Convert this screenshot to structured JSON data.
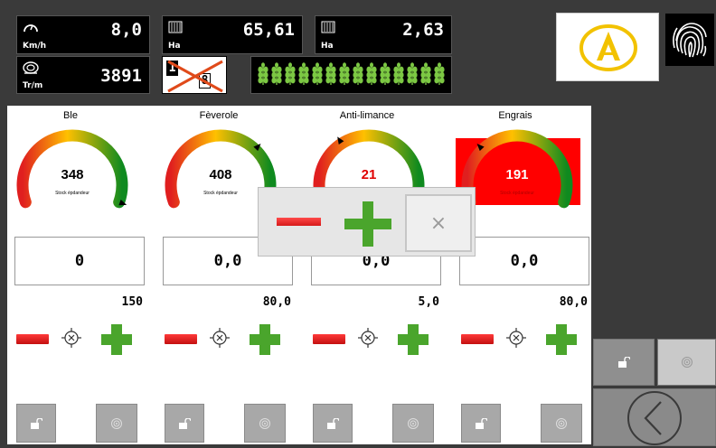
{
  "header": {
    "speed": {
      "value": "8,0",
      "unit": "Km/h",
      "icon": "speedometer-icon"
    },
    "area_total": {
      "value": "65,61",
      "unit": "Ha",
      "icon": "field-icon"
    },
    "area_partial": {
      "value": "2,63",
      "unit": "Ha",
      "icon": "field-icon"
    },
    "rpm": {
      "value": "3891",
      "unit": "Tr/m",
      "icon": "disc-icon"
    },
    "section": {
      "left_digit": "1",
      "right_digit": "8",
      "icon": "section-crossed-icon"
    },
    "seed_count": 14
  },
  "products": [
    {
      "name": "Ble",
      "gauge_value": "348",
      "gauge_sub": "Stock épdandeur",
      "value_color": "#000000",
      "needle_fraction": 1.0,
      "alarm": false,
      "applied": "0",
      "rate": "150"
    },
    {
      "name": "Fèverole",
      "gauge_value": "408",
      "gauge_sub": "Stock épdandeur",
      "value_color": "#000000",
      "needle_fraction": 0.7,
      "alarm": false,
      "applied": "0,0",
      "rate": "80,0"
    },
    {
      "name": "Anti-limance",
      "gauge_value": "21",
      "gauge_sub": "",
      "value_color": "#e00000",
      "needle_fraction": 0.35,
      "alarm": false,
      "applied": "0,0",
      "rate": "5,0"
    },
    {
      "name": "Engrais",
      "gauge_value": "191",
      "gauge_sub": "Stock épdandeur",
      "value_color": "#ffffff",
      "needle_fraction": 0.3,
      "alarm": true,
      "applied": "0,0",
      "rate": "80,0"
    }
  ],
  "popup": {
    "close_label": "×"
  },
  "colors": {
    "minus": "#e02020",
    "plus": "#4aa52c",
    "alarm": "#ff0000",
    "gauge_low": "#e01f1f",
    "gauge_mid": "#ffc000",
    "gauge_high": "#0f8a1f"
  }
}
